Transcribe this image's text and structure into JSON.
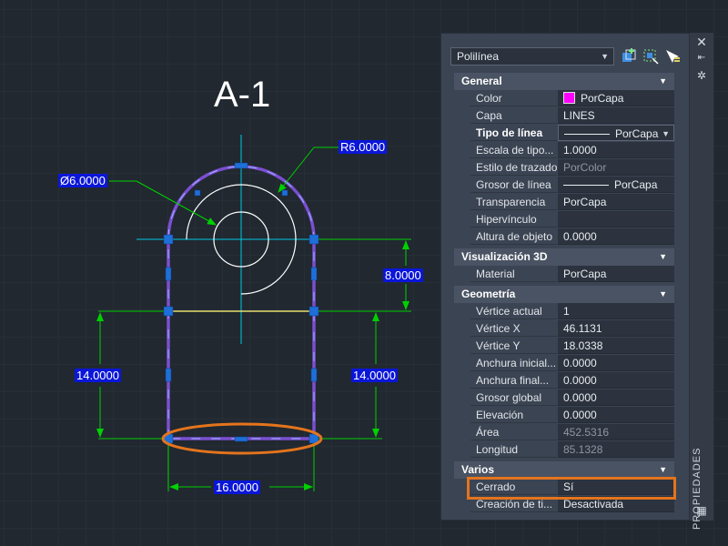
{
  "drawing": {
    "title": "A-1",
    "dim_diameter": "Ø6.0000",
    "dim_radius": "R6.0000",
    "dim_vertical_top": "8.0000",
    "dim_left": "14.0000",
    "dim_right": "14.0000",
    "dim_bottom": "16.0000"
  },
  "palette": {
    "object_type": "Polilínea",
    "side_label": "PROPIEDADES",
    "sections": {
      "general": "General",
      "viz3d": "Visualización 3D",
      "geometry": "Geometría",
      "misc": "Varios"
    },
    "general": [
      {
        "label": "Color",
        "value": "PorCapa"
      },
      {
        "label": "Capa",
        "value": "LINES"
      },
      {
        "label": "Tipo de línea",
        "value": "PorCapa"
      },
      {
        "label": "Escala de tipo...",
        "value": "1.0000"
      },
      {
        "label": "Estilo de trazado",
        "value": "PorColor"
      },
      {
        "label": "Grosor de línea",
        "value": "PorCapa"
      },
      {
        "label": "Transparencia",
        "value": "PorCapa"
      },
      {
        "label": "Hipervínculo",
        "value": ""
      },
      {
        "label": "Altura de objeto",
        "value": "0.0000"
      }
    ],
    "viz3d": [
      {
        "label": "Material",
        "value": "PorCapa"
      }
    ],
    "geometry": [
      {
        "label": "Vértice actual",
        "value": "1"
      },
      {
        "label": "Vértice X",
        "value": "46.1131"
      },
      {
        "label": "Vértice Y",
        "value": "18.0338"
      },
      {
        "label": "Anchura inicial...",
        "value": "0.0000"
      },
      {
        "label": "Anchura final...",
        "value": "0.0000"
      },
      {
        "label": "Grosor global",
        "value": "0.0000"
      },
      {
        "label": "Elevación",
        "value": "0.0000"
      },
      {
        "label": "Área",
        "value": "452.5316"
      },
      {
        "label": "Longitud",
        "value": "85.1328"
      }
    ],
    "misc": [
      {
        "label": "Cerrado",
        "value": "Sí"
      },
      {
        "label": "Creación de ti...",
        "value": "Desactivada"
      }
    ]
  },
  "colors": {
    "background": "#212830",
    "polyline": "#7a4fd0",
    "highlight": "#e4741d",
    "dimension": "#00d000",
    "centerline": "#00c8e0",
    "grip": "#1e6fd8"
  },
  "icons": {
    "close": "close-icon",
    "auto_hide": "auto-hide-icon",
    "settings": "settings-icon",
    "quick_select": "quick-select-icon",
    "select_objects": "select-objects-icon",
    "toggle_pickadd": "toggle-pickadd-icon"
  }
}
